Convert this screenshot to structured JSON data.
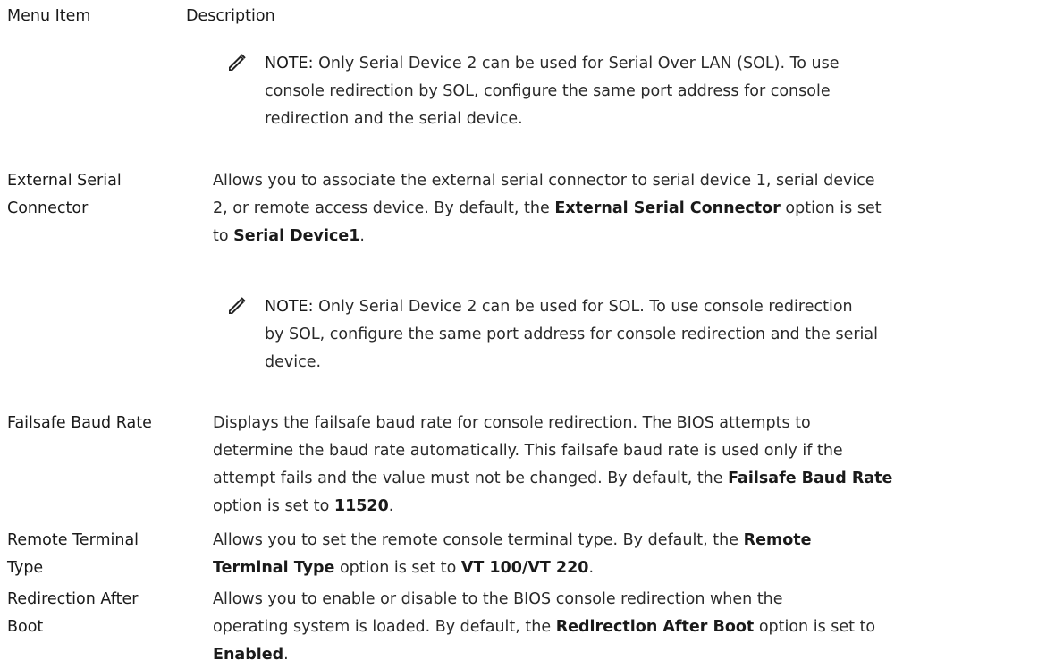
{
  "table": {
    "header": {
      "menu_item": "Menu Item",
      "description": "Description"
    },
    "note_label": "NOTE:",
    "note_icon": "pencil-note-icon",
    "note_1": {
      "line1": "Only Serial Device 2 can be used for Serial Over LAN (SOL). To use",
      "line2": "console redirection by SOL, configure the same port address for console",
      "line3": "redirection and the serial device."
    },
    "external_serial": {
      "label_line1": "External Serial",
      "label_line2": "Connector",
      "desc_line1": "Allows you to associate the external serial connector to serial device 1, serial device",
      "desc_line2_a": "2, or remote access device. By default, the",
      "desc_line2_b": "External Serial Connector",
      "desc_line2_c": "option is set",
      "desc_line3_a": "to",
      "desc_line3_b": "Serial Device1",
      "desc_line3_c": "."
    },
    "note_2": {
      "line1": "Only Serial Device 2 can be used for SOL. To use console redirection",
      "line2": "by SOL, configure the same port address for console redirection and the serial",
      "line3": "device."
    },
    "failsafe": {
      "label": "Failsafe Baud Rate",
      "desc_line1": "Displays the failsafe baud rate for console redirection. The BIOS attempts to",
      "desc_line2": "determine the baud rate automatically. This failsafe baud rate is used only if the",
      "desc_line3_a": "attempt fails and the value must not be changed. By default, the",
      "desc_line3_b": "Failsafe Baud Rate",
      "desc_line4_a": "option is set to",
      "desc_line4_b": "11520",
      "desc_line4_c": "."
    },
    "remote_terminal": {
      "label_line1": "Remote Terminal",
      "label_line2": "Type",
      "desc_line1_a": "Allows you to set the remote console terminal type. By default, the",
      "desc_line1_b": "Remote",
      "desc_line2_a": "Terminal Type",
      "desc_line2_b": "option is set to",
      "desc_line2_c": "VT 100/VT 220",
      "desc_line2_d": "."
    },
    "redirection_after_boot": {
      "label_line1": "Redirection After",
      "label_line2": "Boot",
      "desc_line1": "Allows you to enable or disable to the BIOS console redirection when the",
      "desc_line2_a": "operating system is loaded. By default, the",
      "desc_line2_b": "Redirection After Boot",
      "desc_line2_c": "option is set to",
      "desc_line3_a": "Enabled",
      "desc_line3_b": "."
    }
  }
}
